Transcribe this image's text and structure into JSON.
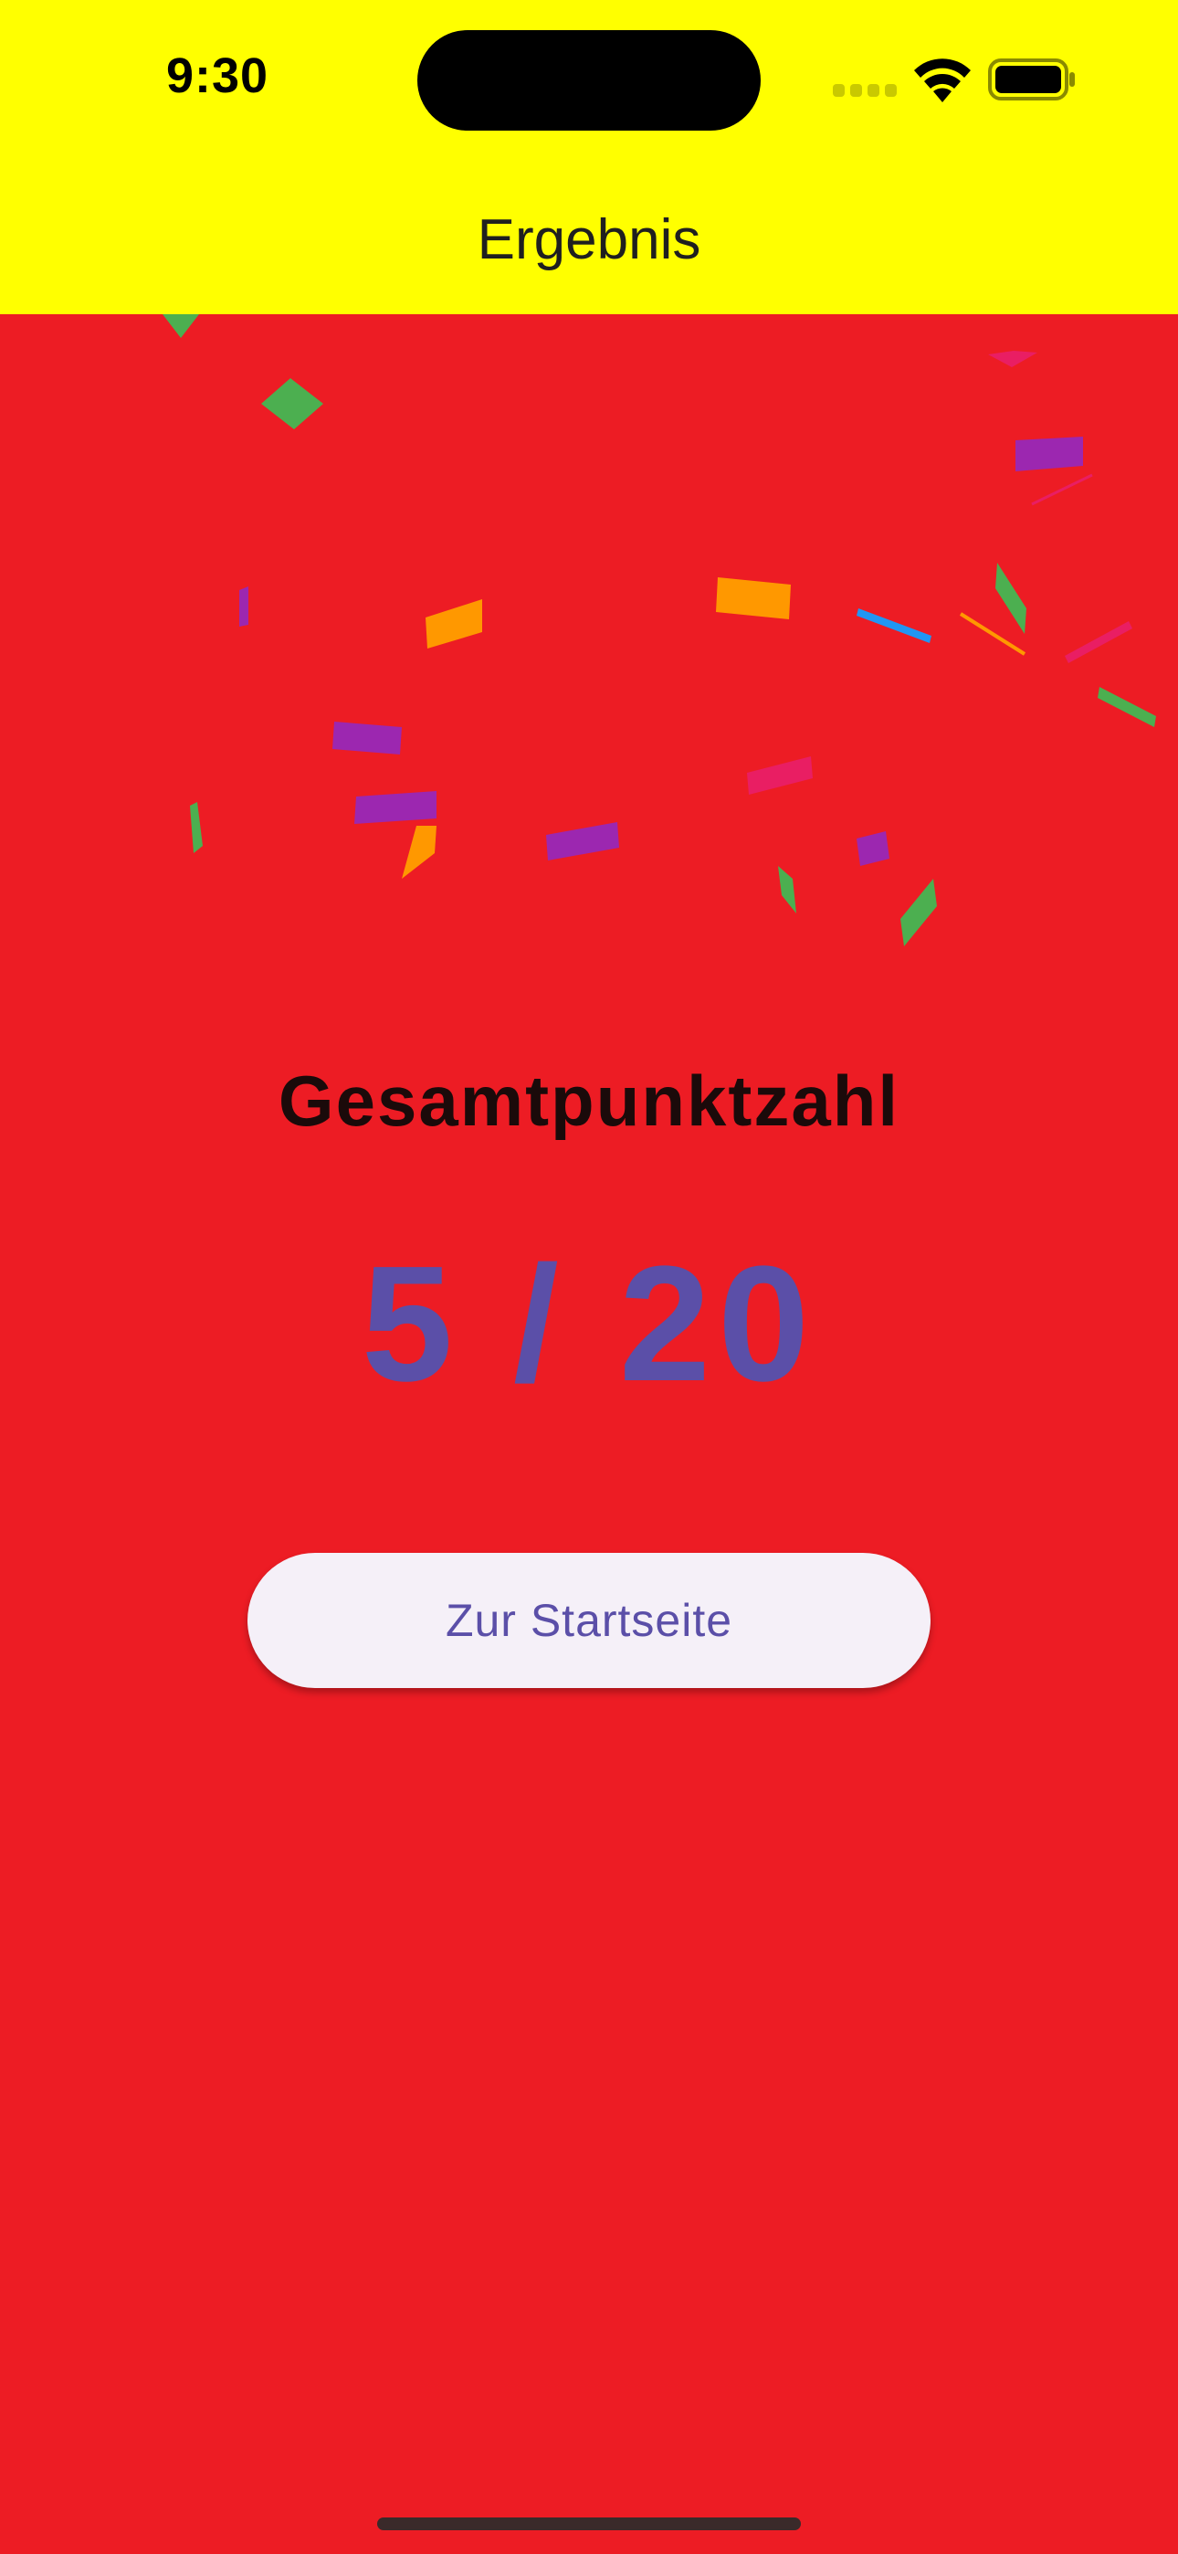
{
  "status_bar": {
    "time": "9:30"
  },
  "header": {
    "title": "Ergebnis"
  },
  "result": {
    "label": "Gesamtpunktzahl",
    "score": "5 / 20"
  },
  "actions": {
    "home_button_label": "Zur Startseite"
  },
  "colors": {
    "background": "#ED1C24",
    "header_background": "#FFFF00",
    "label_text": "#1B0A0A",
    "score_text": "#5B4FA8",
    "button_background": "#F5F0F8",
    "button_text": "#5B4FA8",
    "confetti_green": "#4CAF50",
    "confetti_orange": "#FF9800",
    "confetti_purple": "#9C27B0",
    "confetti_pink": "#E91E63",
    "confetti_blue": "#2196F3"
  },
  "icons": {
    "signal": "cellular-signal-icon",
    "wifi": "wifi-icon",
    "battery": "battery-icon"
  }
}
